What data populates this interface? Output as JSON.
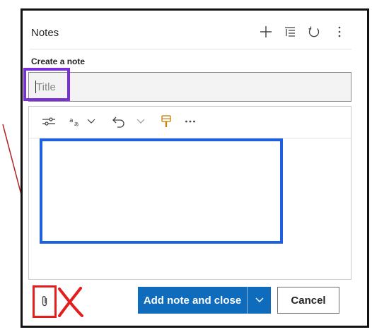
{
  "panel": {
    "title": "Notes",
    "header_icons": [
      "add-icon",
      "sort-icon",
      "refresh-icon",
      "more-vertical-icon"
    ]
  },
  "form": {
    "create_label": "Create a note",
    "title_input": {
      "placeholder": "Title",
      "value": ""
    },
    "toolbar_icons": [
      "format-settings-icon",
      "font-style-icon",
      "chevron-down-icon",
      "undo-icon",
      "chevron-down-icon",
      "format-painter-icon",
      "more-horizontal-icon"
    ],
    "body_text": ""
  },
  "footer": {
    "attach_icon": "paperclip-icon",
    "add_note_label": "Add note and close",
    "cancel_label": "Cancel"
  },
  "annotations": {
    "title_highlight_color": "#7b2fd6",
    "body_highlight_color": "#1f5fe0",
    "attach_highlight_color": "#e41e1e",
    "arrow_color": "#b22222"
  },
  "colors": {
    "primary": "#0f6cbd",
    "border": "#8a8a8a",
    "input_bg": "#f3f3f3"
  }
}
